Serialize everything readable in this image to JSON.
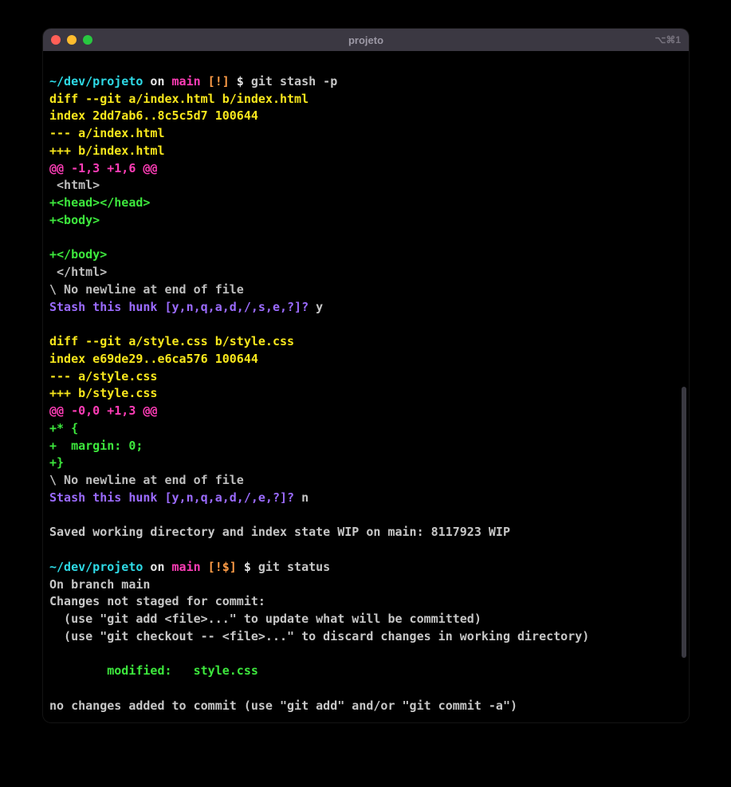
{
  "titlebar": {
    "title": "projeto",
    "shortcut": "⌥⌘1"
  },
  "prompt1": {
    "path": "~/dev/projeto",
    "on": " on ",
    "branch": "main",
    "flags": " [!]",
    "sym": " $ ",
    "cmd": "git stash -p"
  },
  "diff1": {
    "header": "diff --git a/index.html b/index.html",
    "index": "index 2dd7ab6..8c5c5d7 100644",
    "minus": "--- a/index.html",
    "plus": "+++ b/index.html",
    "hunk": "@@ -1,3 +1,6 @@",
    "ctx1": " <html>",
    "add1": "+<head></head>",
    "add2": "+<body>",
    "blank": "",
    "add3": "+</body>",
    "ctx2": " </html>",
    "noeol": "\\ No newline at end of file",
    "stash_q": "Stash this hunk [y,n,q,a,d,/,s,e,?]?",
    "answer": " y"
  },
  "diff2": {
    "header": "diff --git a/style.css b/style.css",
    "index": "index e69de29..e6ca576 100644",
    "minus": "--- a/style.css",
    "plus": "+++ b/style.css",
    "hunk": "@@ -0,0 +1,3 @@",
    "add1": "+* {",
    "add2": "+  margin: 0;",
    "add3": "+}",
    "noeol": "\\ No newline at end of file",
    "stash_q": "Stash this hunk [y,n,q,a,d,/,e,?]?",
    "answer": " n"
  },
  "saved": "Saved working directory and index state WIP on main: 8117923 WIP",
  "prompt2": {
    "path": "~/dev/projeto",
    "on": " on ",
    "branch": "main",
    "flags": " [!$]",
    "sym": " $ ",
    "cmd": "git status"
  },
  "status": {
    "branch": "On branch main",
    "not_staged": "Changes not staged for commit:",
    "hint1": "  (use \"git add <file>...\" to update what will be committed)",
    "hint2": "  (use \"git checkout -- <file>...\" to discard changes in working directory)",
    "blank": "",
    "modified": "        modified:   style.css",
    "no_changes": "no changes added to commit (use \"git add\" and/or \"git commit -a\")"
  }
}
